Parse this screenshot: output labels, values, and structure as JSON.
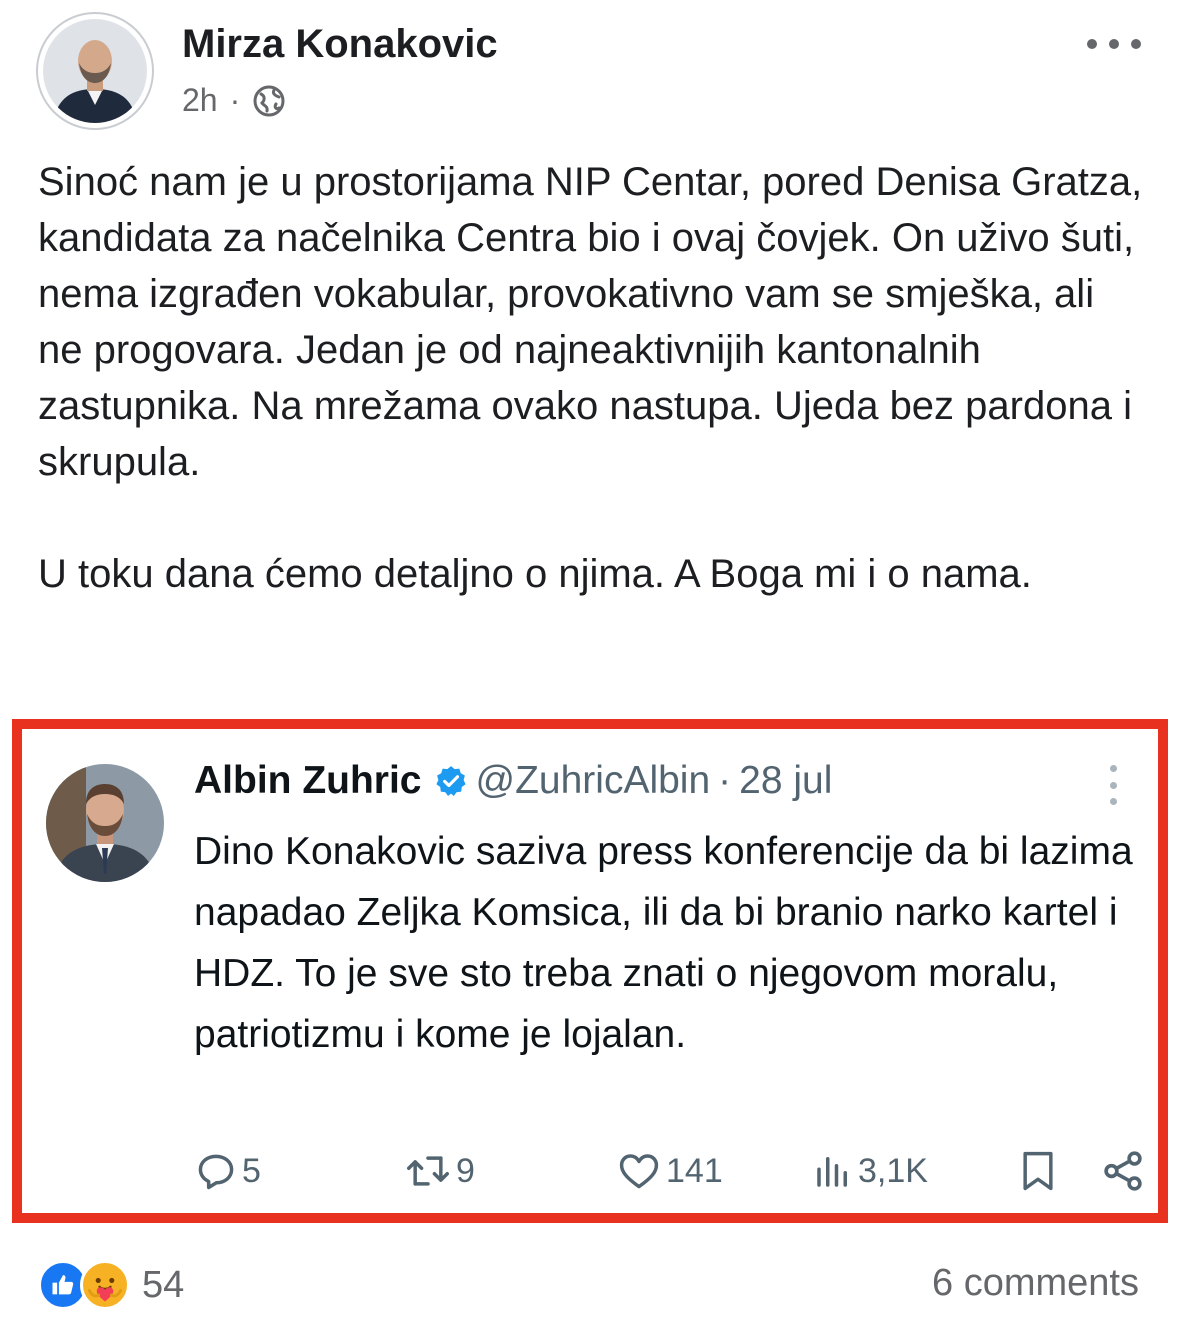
{
  "post": {
    "author": "Mirza Konakovic",
    "time": "2h",
    "separator": "·",
    "audience_icon": "globe-icon",
    "more_icon": "more-horizontal-icon",
    "text": "Sinoć nam je u prostorijama NIP Centar, pored Denisa Gratza, kandidata za načelnika Centra bio i ovaj čovjek. On uživo šuti, nema izgrađen vokabular, provokativno vam se smješka, ali ne progovara. Jedan je od najneaktivnijih kantonalnih zastupnika. Na mrežama ovako nastupa. Ujeda bez pardona i skrupula.\n\nU toku dana ćemo detaljno o njima. A Boga mi i o nama."
  },
  "tweet": {
    "name": "Albin Zuhric",
    "verified_icon": "verified-badge-icon",
    "handle": "@ZuhricAlbin",
    "separator": "·",
    "date": "28 jul",
    "text": "Dino Konakovic saziva press konferencije da bi lazima napadao Zeljka Komsica, ili da bi branio narko kartel i HDZ. To je sve sto treba znati o njegovom moralu, patriotizmu i kome je lojalan.",
    "actions": {
      "replies": "5",
      "retweets": "9",
      "likes": "141",
      "views": "3,1K"
    },
    "highlight_color": "#e8311f"
  },
  "footer": {
    "reaction_count": "54",
    "comments": "6 comments",
    "reaction_icons": [
      "like-icon",
      "care-icon"
    ]
  },
  "colors": {
    "text": "#1c1e21",
    "secondary": "#65676b",
    "tweet_secondary": "#536471",
    "verified": "#1d9bf0",
    "like_blue": "#1877f2"
  }
}
